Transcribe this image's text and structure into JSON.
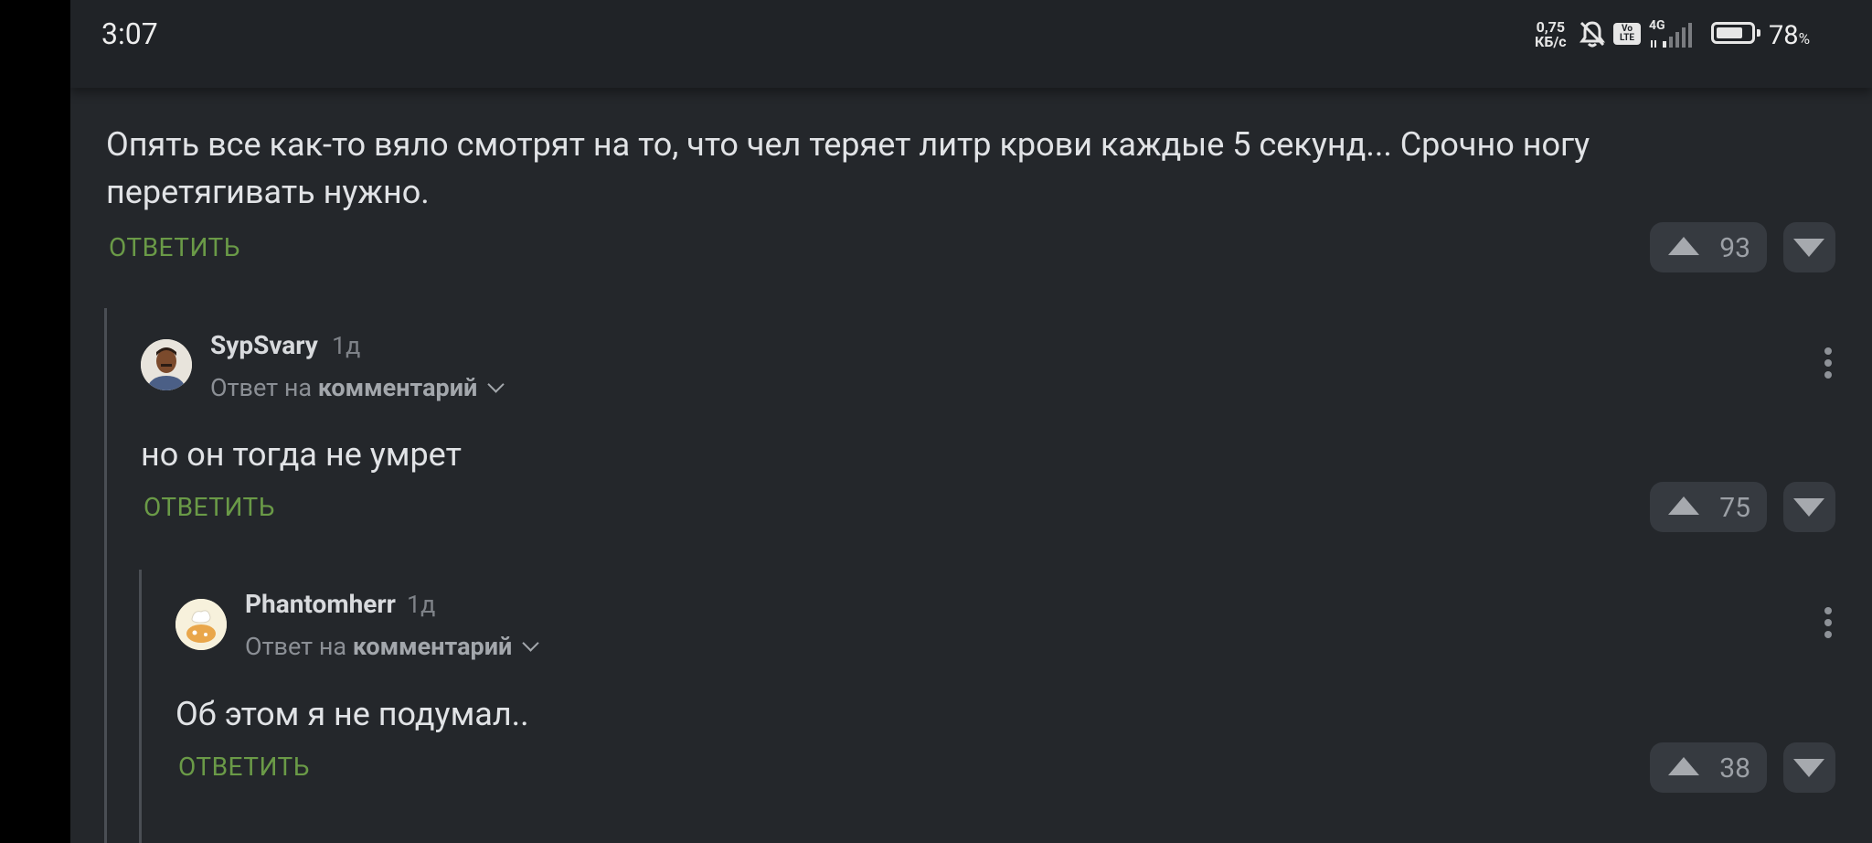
{
  "status_bar": {
    "time": "3:07",
    "net_speed_value": "0,75",
    "net_speed_unit": "КБ/с",
    "volte_label": "Vo LTE",
    "network_type": "4G",
    "battery_percent": "78",
    "battery_percent_sign": "%",
    "battery_level": 0.78
  },
  "top_comment": {
    "text": "Опять все как-то вяло смотрят на то, что чел теряет литр крови каждые 5 секунд... Срочно ногу перетягивать нужно.",
    "reply_label": "ОТВЕТИТЬ",
    "rating": "93"
  },
  "comments": [
    {
      "author": "SypSvary",
      "ago": "1д",
      "reply_prefix": "Ответ на",
      "reply_target": "комментарий",
      "text": "но он тогда не умрет",
      "reply_label": "ОТВЕТИТЬ",
      "rating": "75"
    },
    {
      "author": "Phantomherr",
      "ago": "1д",
      "reply_prefix": "Ответ на",
      "reply_target": "комментарий",
      "text": "Об этом я не подумал..",
      "reply_label": "ОТВЕТИТЬ",
      "rating": "38"
    }
  ],
  "colors": {
    "background": "#24272b",
    "reply_green": "#6a9a47",
    "vote_button": "#363a40"
  }
}
